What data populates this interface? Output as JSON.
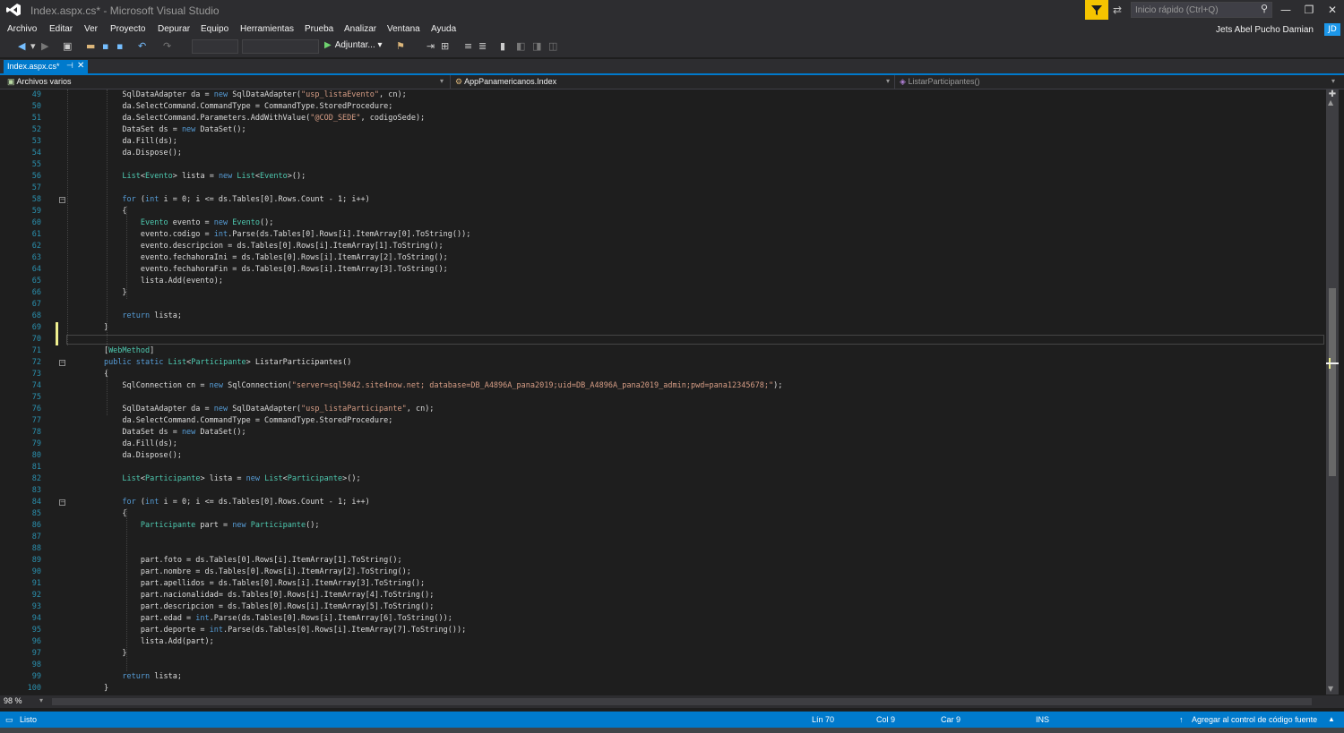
{
  "window": {
    "title": "Index.aspx.cs* - Microsoft Visual Studio"
  },
  "quick_launch": {
    "placeholder": "Inicio rápido (Ctrl+Q)"
  },
  "menu": [
    "Archivo",
    "Editar",
    "Ver",
    "Proyecto",
    "Depurar",
    "Equipo",
    "Herramientas",
    "Prueba",
    "Analizar",
    "Ventana",
    "Ayuda"
  ],
  "user": {
    "name": "Jets Abel Pucho Damian",
    "initials": "JD"
  },
  "toolbar": {
    "attach_label": "Adjuntar..."
  },
  "tab": {
    "label": "Index.aspx.cs*",
    "pin": "⊣",
    "close": "✕"
  },
  "nav": {
    "scope": "Archivos varios",
    "class": "AppPanamericanos.Index",
    "member": "ListarParticipantes()"
  },
  "zoom": "98 %",
  "status": {
    "ready": "Listo",
    "line": "Lín 70",
    "col": "Col 9",
    "char": "Car 9",
    "mode": "INS",
    "source_control": "Agregar al control de código fuente"
  },
  "code_lines": [
    {
      "n": "49",
      "html": "            SqlDataAdapter da = <span class=\"k\">new</span> SqlDataAdapter(<span class=\"s\">\"usp_listaEvento\"</span>, cn);"
    },
    {
      "n": "50",
      "html": "            da.SelectCommand.CommandType = CommandType.StoredProcedure;"
    },
    {
      "n": "51",
      "html": "            da.SelectCommand.Parameters.AddWithValue(<span class=\"s\">\"@COD_SEDE\"</span>, codigoSede);"
    },
    {
      "n": "52",
      "html": "            DataSet ds = <span class=\"k\">new</span> DataSet();"
    },
    {
      "n": "53",
      "html": "            da.Fill(ds);"
    },
    {
      "n": "54",
      "html": "            da.Dispose();"
    },
    {
      "n": "55",
      "html": ""
    },
    {
      "n": "56",
      "html": "            <span class=\"t\">List</span>&lt;<span class=\"t\">Evento</span>&gt; lista = <span class=\"k\">new</span> <span class=\"t\">List</span>&lt;<span class=\"t\">Evento</span>&gt;();"
    },
    {
      "n": "57",
      "html": ""
    },
    {
      "n": "58",
      "html": "            <span class=\"k\">for</span> (<span class=\"k\">int</span> i = 0; i &lt;= ds.Tables[0].Rows.Count - 1; i++)",
      "fold": true
    },
    {
      "n": "59",
      "html": "            {"
    },
    {
      "n": "60",
      "html": "                <span class=\"t\">Evento</span> evento = <span class=\"k\">new</span> <span class=\"t\">Evento</span>();"
    },
    {
      "n": "61",
      "html": "                evento.codigo = <span class=\"k\">int</span>.Parse(ds.Tables[0].Rows[i].ItemArray[0].ToString());"
    },
    {
      "n": "62",
      "html": "                evento.descripcion = ds.Tables[0].Rows[i].ItemArray[1].ToString();"
    },
    {
      "n": "63",
      "html": "                evento.fechahoraIni = ds.Tables[0].Rows[i].ItemArray[2].ToString();"
    },
    {
      "n": "64",
      "html": "                evento.fechahoraFin = ds.Tables[0].Rows[i].ItemArray[3].ToString();"
    },
    {
      "n": "65",
      "html": "                lista.Add(evento);"
    },
    {
      "n": "66",
      "html": "            }"
    },
    {
      "n": "67",
      "html": ""
    },
    {
      "n": "68",
      "html": "            <span class=\"k\">return</span> lista;"
    },
    {
      "n": "69",
      "html": "        }",
      "mark": true
    },
    {
      "n": "70",
      "html": "",
      "mark": true,
      "current": true
    },
    {
      "n": "71",
      "html": "        [<span class=\"t\">WebMethod</span>]"
    },
    {
      "n": "72",
      "html": "        <span class=\"k\">public</span> <span class=\"k\">static</span> <span class=\"t\">List</span>&lt;<span class=\"t\">Participante</span>&gt; ListarParticipantes()",
      "fold": true
    },
    {
      "n": "73",
      "html": "        {"
    },
    {
      "n": "74",
      "html": "            SqlConnection cn = <span class=\"k\">new</span> SqlConnection(<span class=\"s\">\"server=sql5042.site4now.net; database=DB_A4896A_pana2019;uid=DB_A4896A_pana2019_admin;pwd=pana12345678;\"</span>);"
    },
    {
      "n": "75",
      "html": ""
    },
    {
      "n": "76",
      "html": "            SqlDataAdapter da = <span class=\"k\">new</span> SqlDataAdapter(<span class=\"s\">\"usp_listaParticipante\"</span>, cn);"
    },
    {
      "n": "77",
      "html": "            da.SelectCommand.CommandType = CommandType.StoredProcedure;"
    },
    {
      "n": "78",
      "html": "            DataSet ds = <span class=\"k\">new</span> DataSet();"
    },
    {
      "n": "79",
      "html": "            da.Fill(ds);"
    },
    {
      "n": "80",
      "html": "            da.Dispose();"
    },
    {
      "n": "81",
      "html": ""
    },
    {
      "n": "82",
      "html": "            <span class=\"t\">List</span>&lt;<span class=\"t\">Participante</span>&gt; lista = <span class=\"k\">new</span> <span class=\"t\">List</span>&lt;<span class=\"t\">Participante</span>&gt;();"
    },
    {
      "n": "83",
      "html": ""
    },
    {
      "n": "84",
      "html": "            <span class=\"k\">for</span> (<span class=\"k\">int</span> i = 0; i &lt;= ds.Tables[0].Rows.Count - 1; i++)",
      "fold": true
    },
    {
      "n": "85",
      "html": "            {"
    },
    {
      "n": "86",
      "html": "                <span class=\"t\">Participante</span> part = <span class=\"k\">new</span> <span class=\"t\">Participante</span>();"
    },
    {
      "n": "87",
      "html": ""
    },
    {
      "n": "88",
      "html": ""
    },
    {
      "n": "89",
      "html": "                part.foto = ds.Tables[0].Rows[i].ItemArray[1].ToString();"
    },
    {
      "n": "90",
      "html": "                part.nombre = ds.Tables[0].Rows[i].ItemArray[2].ToString();"
    },
    {
      "n": "91",
      "html": "                part.apellidos = ds.Tables[0].Rows[i].ItemArray[3].ToString();"
    },
    {
      "n": "92",
      "html": "                part.nacionalidad= ds.Tables[0].Rows[i].ItemArray[4].ToString();"
    },
    {
      "n": "93",
      "html": "                part.descripcion = ds.Tables[0].Rows[i].ItemArray[5].ToString();"
    },
    {
      "n": "94",
      "html": "                part.edad = <span class=\"k\">int</span>.Parse(ds.Tables[0].Rows[i].ItemArray[6].ToString());"
    },
    {
      "n": "95",
      "html": "                part.deporte = <span class=\"k\">int</span>.Parse(ds.Tables[0].Rows[i].ItemArray[7].ToString());"
    },
    {
      "n": "96",
      "html": "                lista.Add(part);"
    },
    {
      "n": "97",
      "html": "            }"
    },
    {
      "n": "98",
      "html": ""
    },
    {
      "n": "99",
      "html": "            <span class=\"k\">return</span> lista;"
    },
    {
      "n": "100",
      "html": "        }"
    }
  ]
}
